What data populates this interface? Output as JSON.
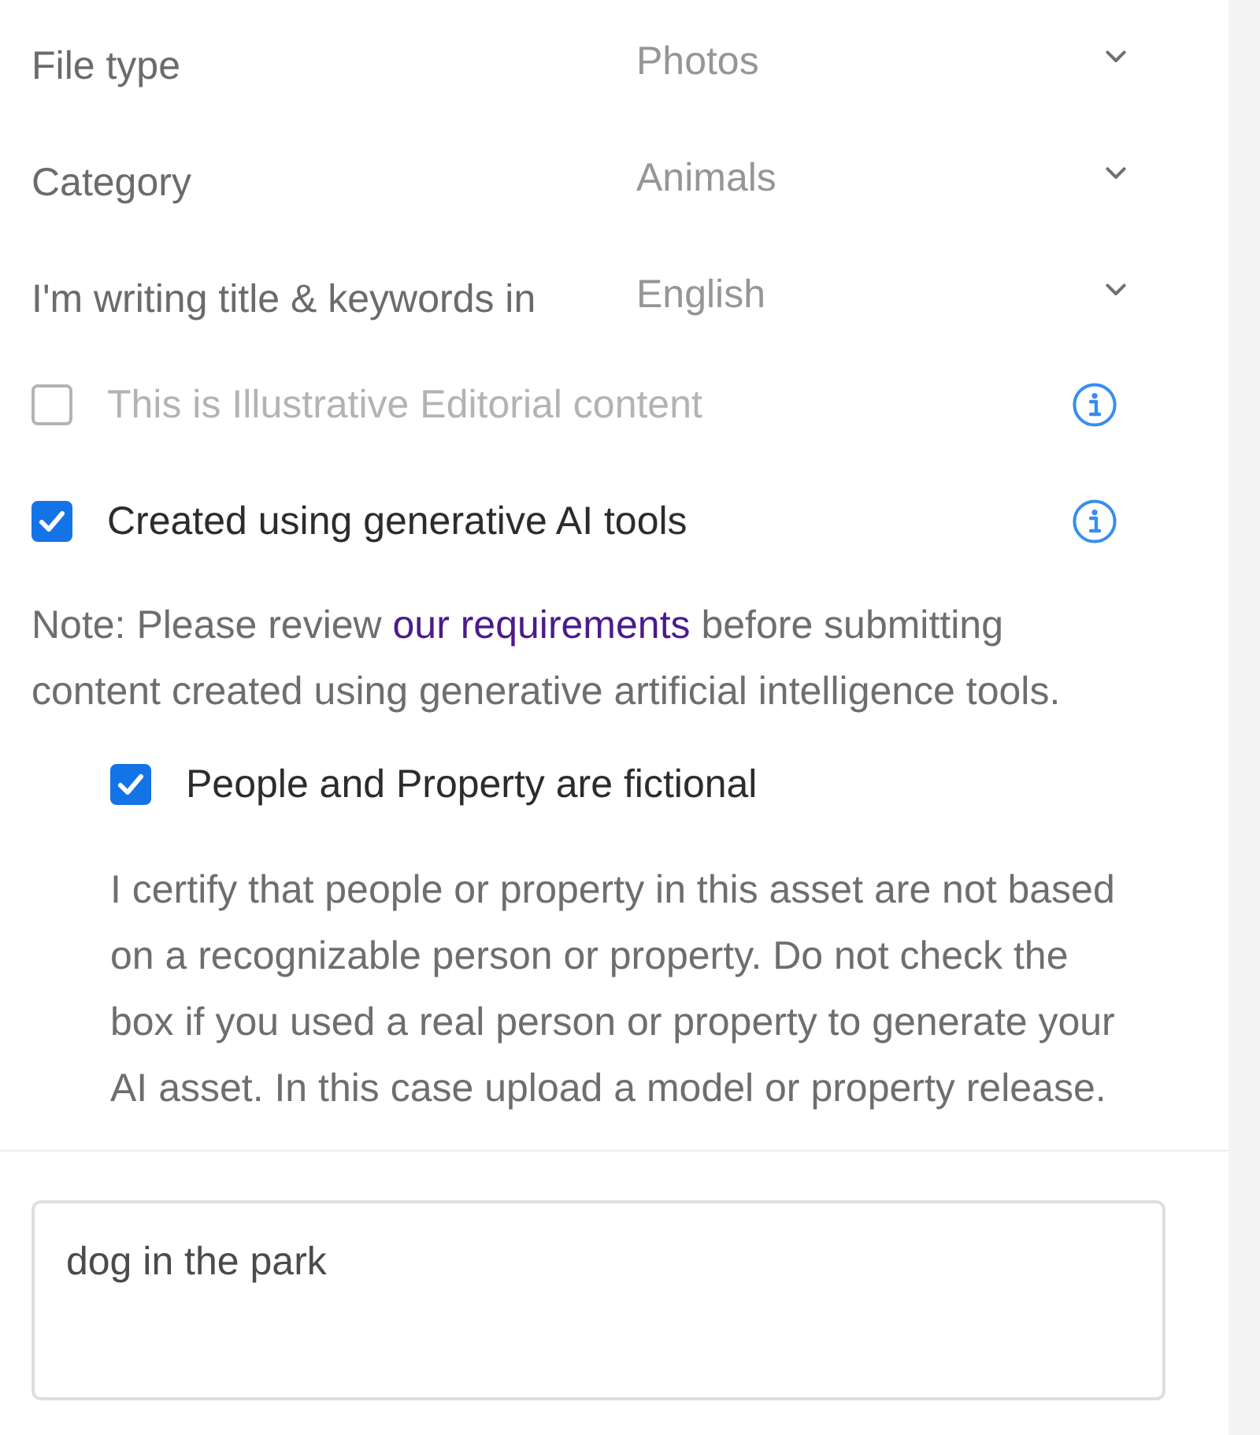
{
  "dropdowns": [
    {
      "label": "File type",
      "value": "Photos"
    },
    {
      "label": "Category",
      "value": "Animals"
    },
    {
      "label": "I'm writing title & keywords in",
      "value": "English"
    }
  ],
  "options": [
    {
      "label": "This is Illustrative Editorial content",
      "checked": false,
      "disabled": true
    },
    {
      "label": "Created using generative AI tools",
      "checked": true,
      "disabled": false
    }
  ],
  "note": {
    "before": "Note: Please review ",
    "link": "our requirements",
    "after": " before submitting content created using generative artificial intelligence tools."
  },
  "sub_option": {
    "label": "People and Property are fictional",
    "checked": true,
    "disabled": false
  },
  "certification": "I certify that people or property in this asset are not based on a recognizable person or property. Do not check the box if you used a real person or property to generate your AI asset. In this case upload a model or property release.",
  "description_field": {
    "value": "dog in the park"
  }
}
